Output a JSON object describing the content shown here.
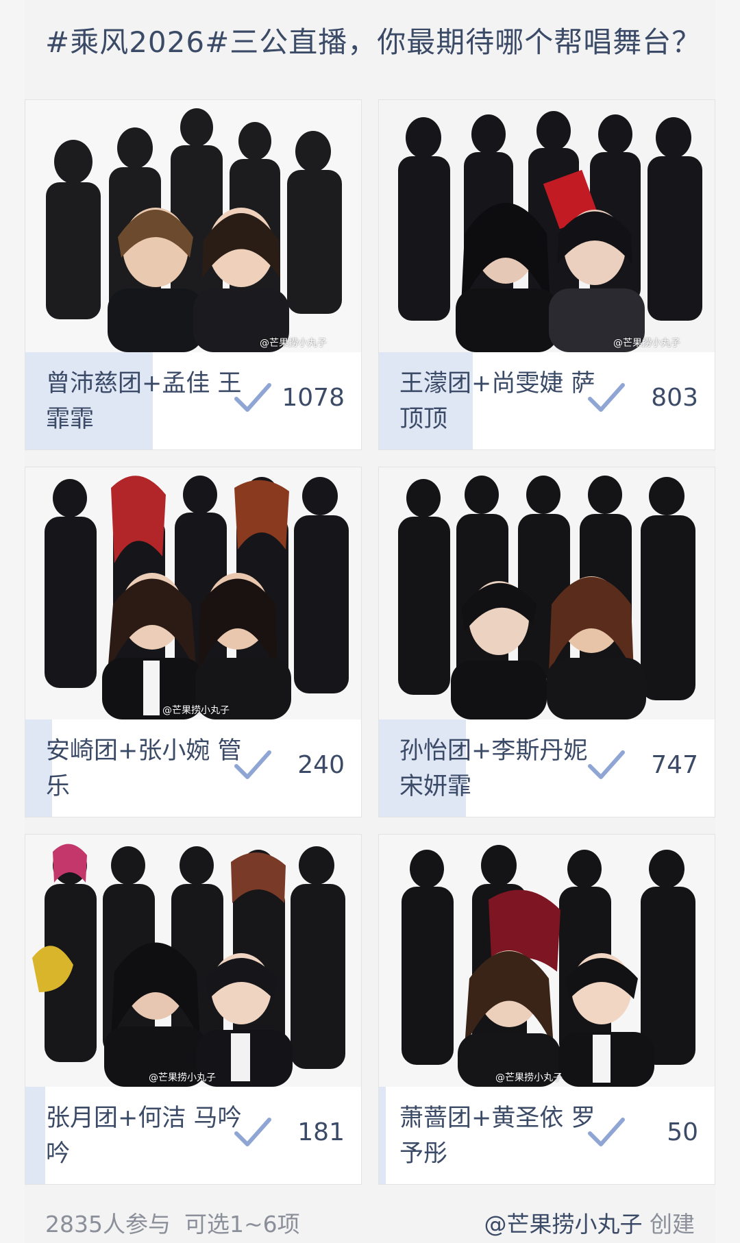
{
  "poll": {
    "title": "#乘风2026#三公直播，你最期待哪个帮唱舞台？",
    "watermark": "@芒果捞小丸子",
    "options": [
      {
        "label": "曾沛慈团+孟佳 王霏霏",
        "votes": "1078",
        "share": 0.38
      },
      {
        "label": "王濛团+尚雯婕 萨顶顶",
        "votes": "803",
        "share": 0.28
      },
      {
        "label": "安崎团+张小婉 管乐",
        "votes": "240",
        "share": 0.08
      },
      {
        "label": "孙怡团+李斯丹妮 宋妍霏",
        "votes": "747",
        "share": 0.26
      },
      {
        "label": "张月团+何洁 马吟吟",
        "votes": "181",
        "share": 0.06
      },
      {
        "label": "萧蔷团+黄圣依 罗予彤",
        "votes": "50",
        "share": 0.02
      }
    ]
  },
  "footer": {
    "participants": "2835人参与",
    "selectable": "可选1~6项",
    "author": "@芒果捞小丸子",
    "created": "创建"
  },
  "colors": {
    "text": "#3b4a66",
    "fill": "#dfe6f4",
    "check": "#8fa6d4",
    "muted": "#8a8f99"
  }
}
